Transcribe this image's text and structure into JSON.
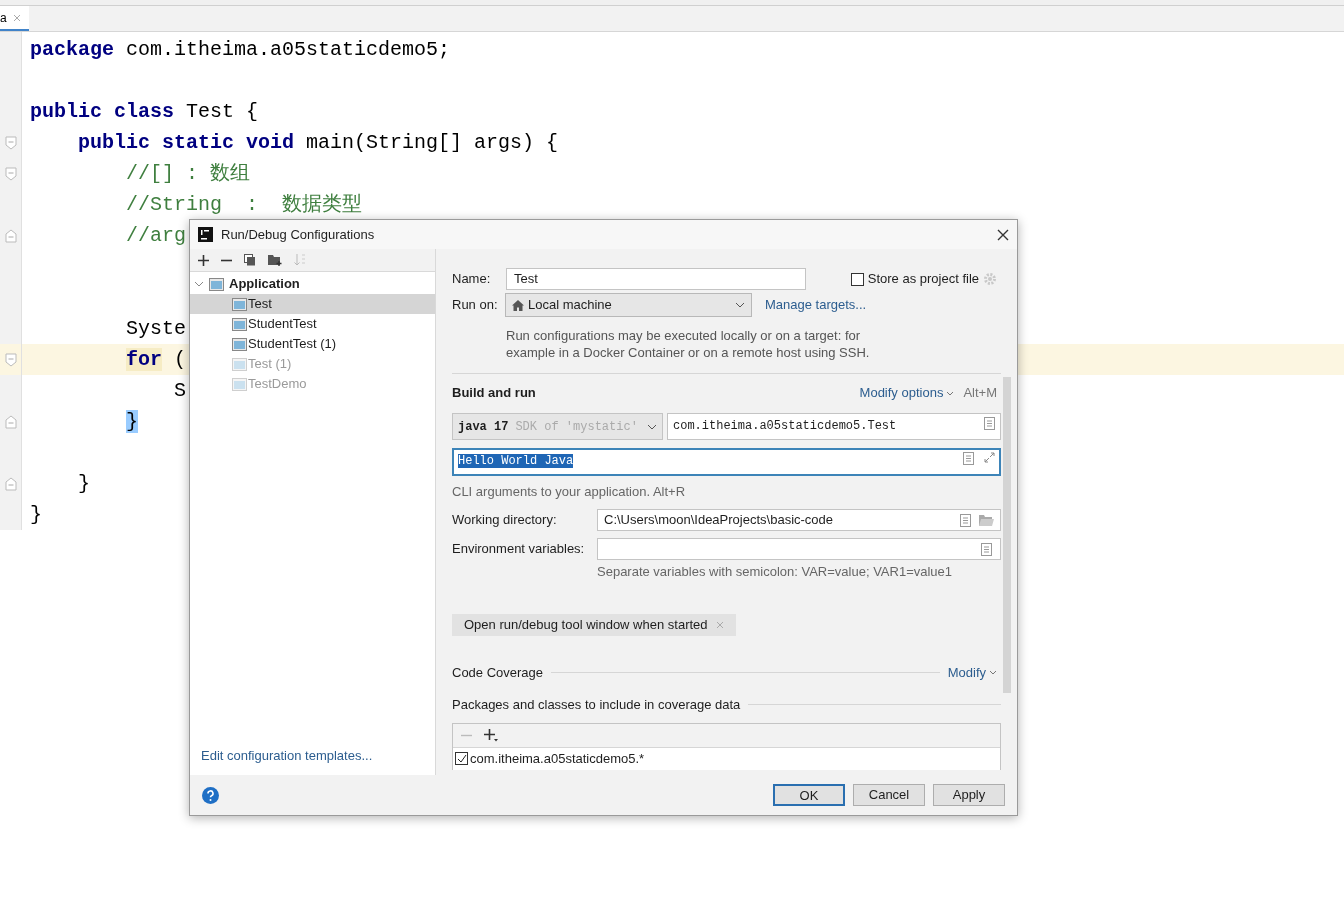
{
  "editor": {
    "tab": {
      "label": "a"
    },
    "lines": [
      {
        "segments": [
          {
            "kind": "keyword",
            "text": "package"
          },
          {
            "kind": "plain",
            "text": " com.itheima.a05staticdemo5;"
          }
        ]
      },
      {
        "blank_before": true,
        "segments": [
          {
            "kind": "keyword",
            "text": "public class"
          },
          {
            "kind": "plain",
            "text": " Test {"
          }
        ]
      },
      {
        "fold_start": true,
        "segments": [
          {
            "kind": "keyword",
            "text": "    public static void"
          },
          {
            "kind": "plain",
            "text": " main(String[] args) {"
          }
        ]
      },
      {
        "fold_start": true,
        "segments": [
          {
            "kind": "comment",
            "text": "        //[] : 数组"
          }
        ]
      },
      {
        "segments": [
          {
            "kind": "comment",
            "text": "        //String  :  数据类型"
          }
        ]
      },
      {
        "fold_start": false,
        "blank_after": true,
        "segments": [
          {
            "kind": "comment",
            "text": "        //arg"
          }
        ]
      },
      {
        "blank_before": true,
        "segments": [
          {
            "kind": "plain",
            "text": "        Syste"
          }
        ]
      },
      {
        "fold_start": true,
        "highlighted": true,
        "segments": [
          {
            "kind": "keyword",
            "text": "        for",
            "matched": true
          },
          {
            "kind": "plain",
            "text": " ("
          }
        ]
      },
      {
        "segments": [
          {
            "kind": "plain",
            "text": "            S"
          }
        ]
      },
      {
        "fold_start": false,
        "segments": [
          {
            "kind": "plain",
            "text": "        }",
            "matched": true
          }
        ]
      },
      {
        "blank_before": true,
        "fold_start": false,
        "segments": [
          {
            "kind": "plain",
            "text": "    }"
          }
        ]
      },
      {
        "segments": [
          {
            "kind": "plain",
            "text": "}"
          }
        ]
      }
    ]
  },
  "dialog": {
    "title": "Run/Debug Configurations",
    "tree": {
      "label": "Application",
      "expanded": true,
      "children": [
        {
          "label": "Test",
          "selected": true,
          "enabled": true
        },
        {
          "label": "StudentTest",
          "selected": false,
          "enabled": true
        },
        {
          "label": "StudentTest (1)",
          "selected": false,
          "enabled": true
        },
        {
          "label": "Test (1)",
          "selected": false,
          "enabled": false
        },
        {
          "label": "TestDemo",
          "selected": false,
          "enabled": false
        }
      ]
    },
    "templates_link": "Edit configuration templates...",
    "name": {
      "label": "Name:",
      "value": "Test"
    },
    "store": {
      "label": "Store as project file",
      "checked": false
    },
    "run_on": {
      "label": "Run on:",
      "value": "Local machine",
      "link": "Manage targets...",
      "hint": "Run configurations may be executed locally or on a target: for example in a Docker Container or on a remote host using SSH."
    },
    "build": {
      "title": "Build and run",
      "modify": "Modify options",
      "shortcut": "Alt+M",
      "jdk": {
        "version": "java 17",
        "detail": "SDK of 'mystatic'"
      },
      "main_class": "com.itheima.a05staticdemo5.Test",
      "program_args": "Hello World Java",
      "args_hint": "CLI arguments to your application. Alt+R",
      "working_dir": {
        "label": "Working directory:",
        "value": "C:\\Users\\moon\\IdeaProjects\\basic-code"
      },
      "env": {
        "label": "Environment variables:",
        "hint": "Separate variables with semicolon: VAR=value; VAR1=value1"
      },
      "chip": "Open run/debug tool window when started"
    },
    "coverage": {
      "title": "Code Coverage",
      "modify": "Modify",
      "packages_title": "Packages and classes to include in coverage data",
      "packages": [
        {
          "label": "com.itheima.a05staticdemo5.*",
          "checked": true
        }
      ]
    },
    "buttons": [
      {
        "label": "OK",
        "default": true
      },
      {
        "label": "Cancel",
        "default": false
      },
      {
        "label": "Apply",
        "default": false
      }
    ]
  }
}
